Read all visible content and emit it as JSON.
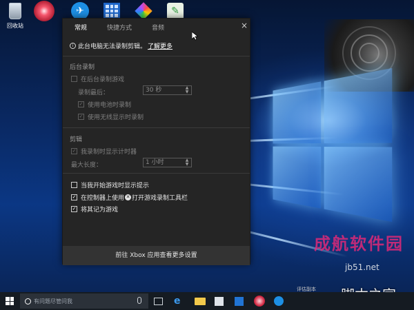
{
  "desktop": {
    "recycle_bin_label": "回收站"
  },
  "panel": {
    "tabs": [
      {
        "label": "常规",
        "active": true
      },
      {
        "label": "快捷方式",
        "active": false
      },
      {
        "label": "音频",
        "active": false
      }
    ],
    "close_glyph": "×",
    "info": {
      "text": "此台电脑无法录制剪辑。",
      "link": "了解更多"
    },
    "background_recording": {
      "title": "后台录制",
      "record_in_background": {
        "label": "在后台录制游戏",
        "checked": false
      },
      "record_last_label": "录制最后：",
      "record_last_value": "30 秒",
      "on_battery": {
        "label": "使用电池时录制",
        "checked": true
      },
      "wireless_display": {
        "label": "使用无线显示时录制",
        "checked": true
      }
    },
    "clips": {
      "title": "剪辑",
      "show_timer": {
        "label": "我录制时显示计时器",
        "checked": true
      },
      "max_length_label": "最大长度：",
      "max_length_value": "1 小时"
    },
    "options": {
      "show_tips": {
        "label": "当我开始游戏时显示提示",
        "checked": false
      },
      "controller_open_prefix": "在控制器上使用",
      "controller_open_suffix": "打开游戏录制工具栏",
      "controller_open_checked": true,
      "remember_game": {
        "label": "将其记为游戏",
        "checked": true
      }
    },
    "footer_button": "前往 Xbox 应用查看更多设置"
  },
  "taskbar": {
    "search_placeholder": "有问题尽管问我"
  },
  "watermarks": {
    "red": "成航软件园",
    "grey": "jb51.net",
    "site": "脚本之家",
    "small": "评估副本"
  },
  "icons": {
    "check": "✓",
    "stepper_up": "▲",
    "stepper_down": "▼",
    "edge": "e",
    "xbox": "✕"
  }
}
